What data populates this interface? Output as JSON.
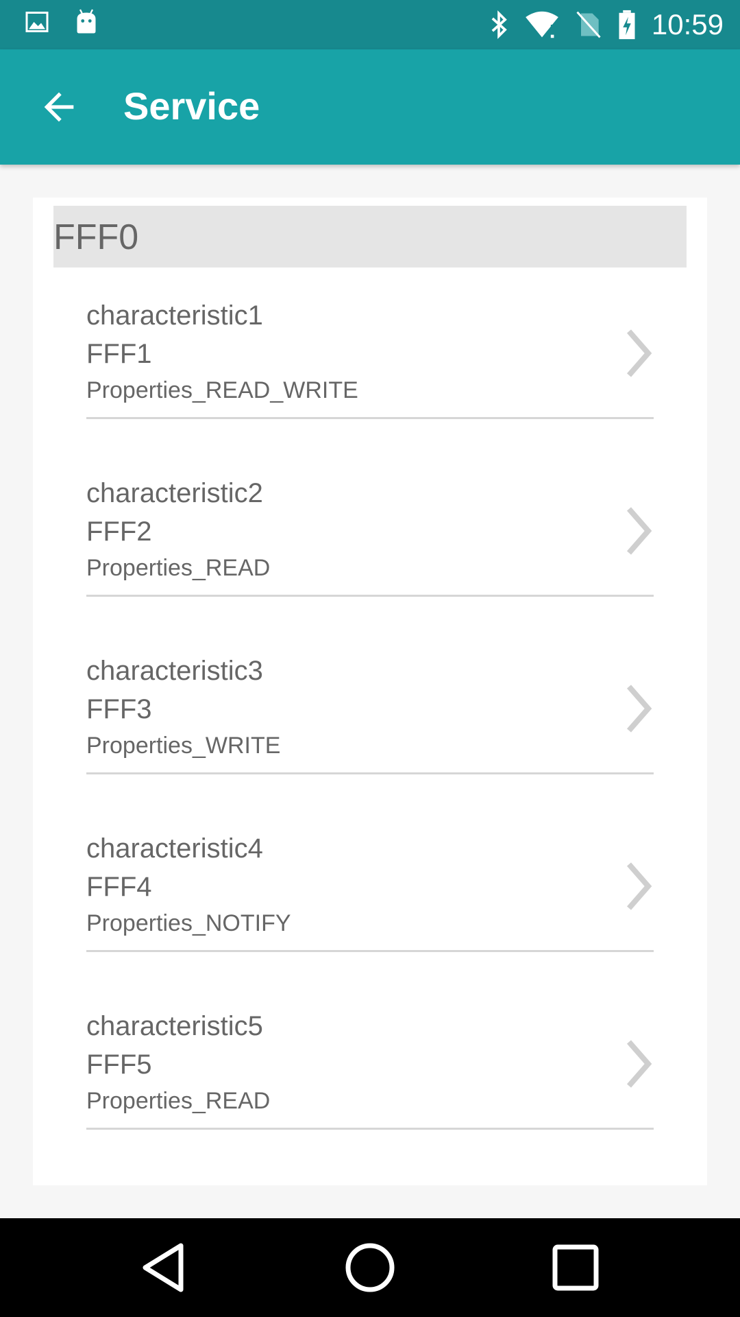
{
  "status_bar": {
    "time": "10:59",
    "icons": [
      "image-icon",
      "android-icon",
      "bluetooth-icon",
      "wifi-alert-icon",
      "no-sim-icon",
      "battery-charging-icon"
    ]
  },
  "app_bar": {
    "title": "Service",
    "back_icon": "arrow-back-icon"
  },
  "service": {
    "uuid": "FFF0",
    "characteristics": [
      {
        "name": "characteristic1",
        "uuid": "FFF1",
        "properties": "Properties_READ_WRITE"
      },
      {
        "name": "characteristic2",
        "uuid": "FFF2",
        "properties": "Properties_READ"
      },
      {
        "name": "characteristic3",
        "uuid": "FFF3",
        "properties": "Properties_WRITE"
      },
      {
        "name": "characteristic4",
        "uuid": "FFF4",
        "properties": "Properties_NOTIFY"
      },
      {
        "name": "characteristic5",
        "uuid": "FFF5",
        "properties": "Properties_READ"
      }
    ]
  },
  "nav_bar": {
    "icons": [
      "back-triangle-icon",
      "home-circle-icon",
      "recents-square-icon"
    ]
  },
  "colors": {
    "status_bar": "#17898e",
    "app_bar": "#18a3a7",
    "header_bg": "#e5e5e5",
    "text": "#666666"
  }
}
